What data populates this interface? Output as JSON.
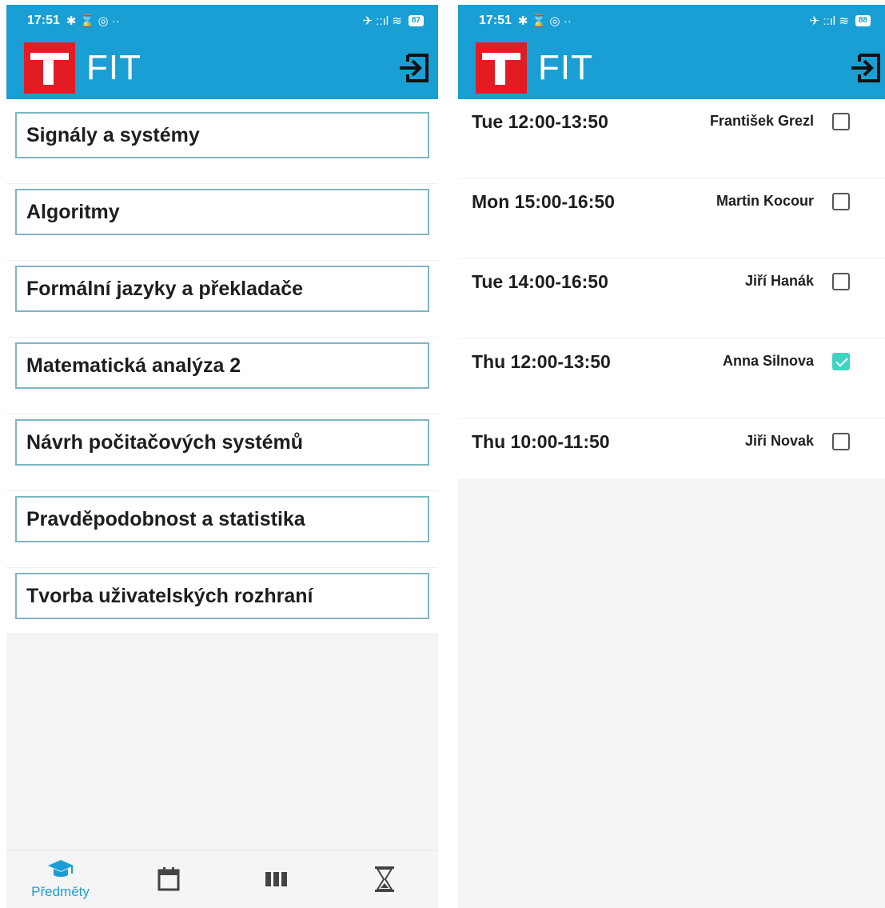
{
  "left_screen": {
    "status": {
      "time": "17:51",
      "icons_left": "✱ ⌛ ◎ ··",
      "icons_right": "✈ ::ıl ≋",
      "battery": "87"
    },
    "app_title": "FIT",
    "courses": [
      "Signály a systémy",
      "Algoritmy",
      "Formální jazyky a překladače",
      "Matematická analýza 2",
      "Návrh počitačových systémů",
      "Pravděpodobnost a statistika",
      "Tvorba uživatelských rozhraní"
    ],
    "bottom_nav": {
      "active_label": "Předměty",
      "items": [
        "graduation-cap-icon",
        "calendar-icon",
        "columns-icon",
        "hourglass-icon"
      ],
      "active_color": "#1a9fd4"
    }
  },
  "right_screen": {
    "status": {
      "time": "17:51",
      "icons_left": "✱ ⌛ ◎ ··",
      "icons_right": "✈ ::ıl ≋",
      "battery": "88"
    },
    "app_title": "FIT",
    "slots": [
      {
        "time": "Tue  12:00-13:50",
        "teacher": "František Grezl",
        "checked": false
      },
      {
        "time": "Mon  15:00-16:50",
        "teacher": "Martin Kocour",
        "checked": false
      },
      {
        "time": "Tue  14:00-16:50",
        "teacher": "Jiří Hanák",
        "checked": false
      },
      {
        "time": "Thu  12:00-13:50",
        "teacher": "Anna Silnova",
        "checked": true
      },
      {
        "time": "Thu  10:00-11:50",
        "teacher": "Jiři Novak",
        "checked": false
      }
    ]
  },
  "colors": {
    "primary": "#1a9fd4",
    "logo_red": "#e31b23",
    "check": "#3ed3c3"
  }
}
